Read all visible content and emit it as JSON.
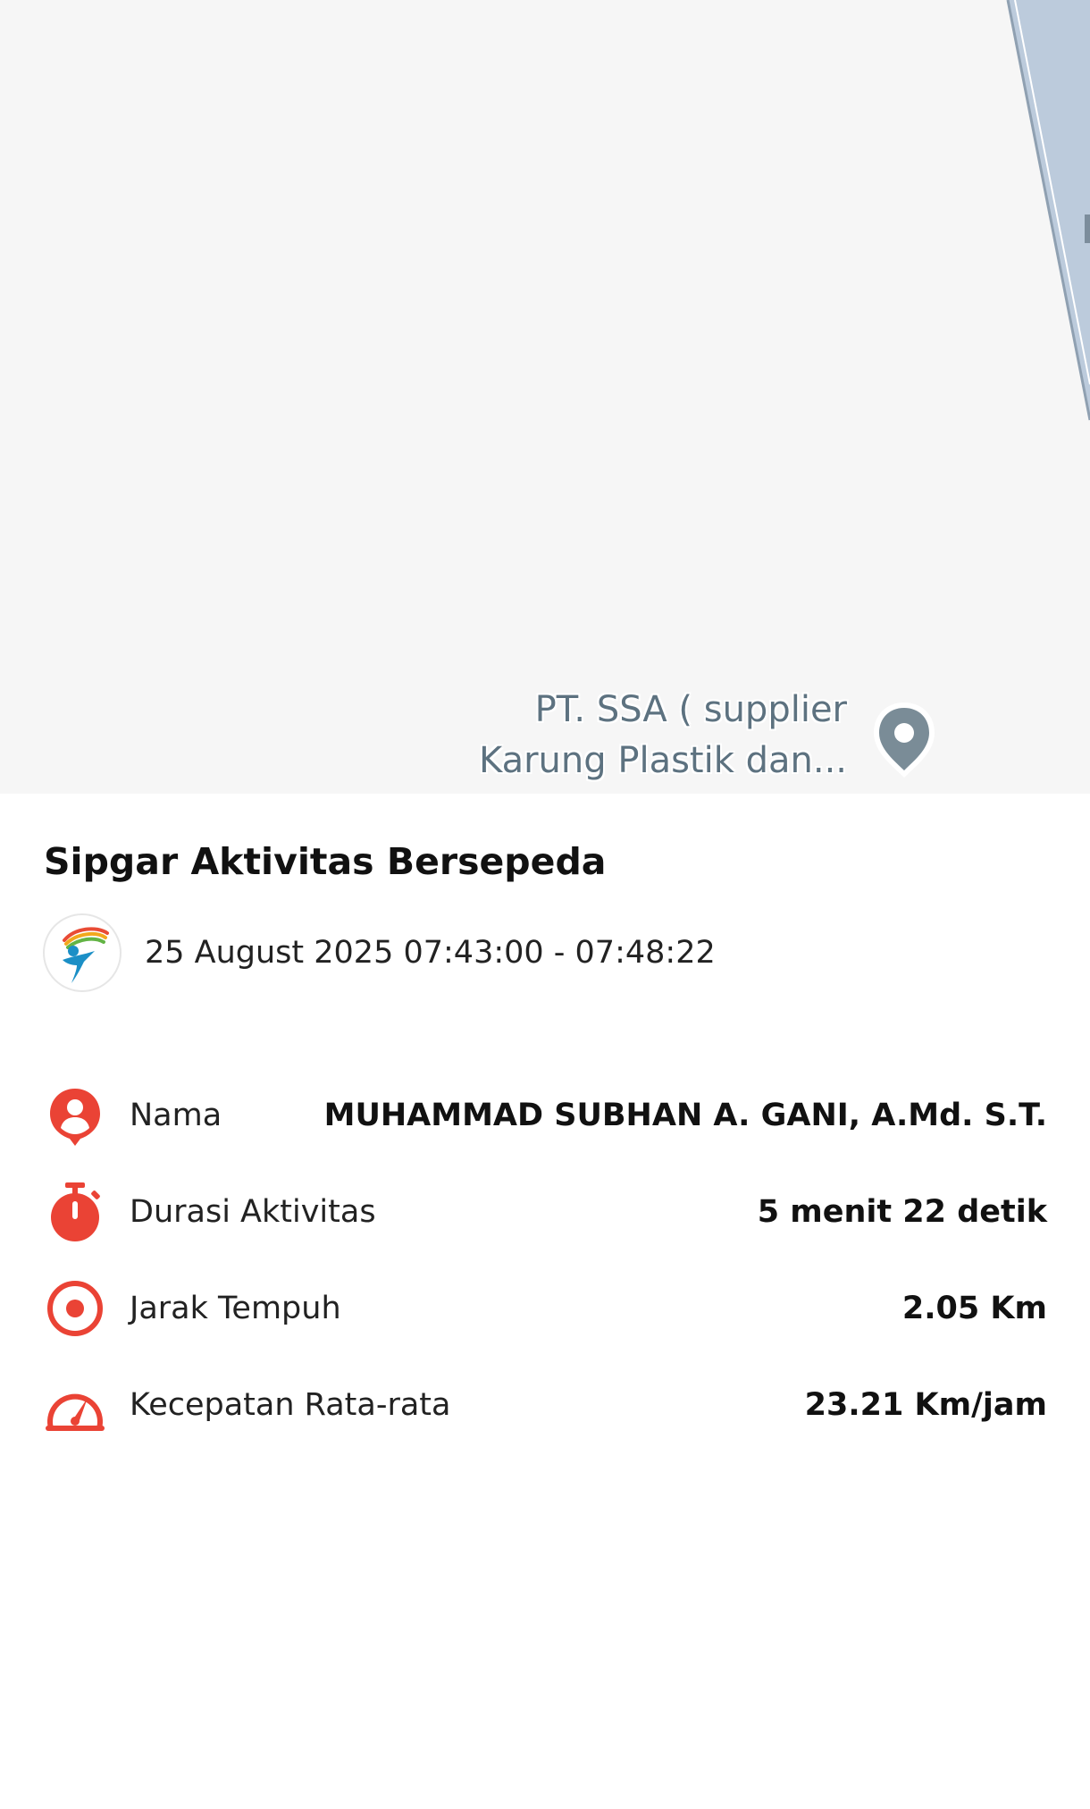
{
  "map": {
    "poi_label_line1": "PT. SSA ( supplier",
    "poi_label_line2": "Karung Plastik dan...",
    "water_color": "#bccbdc",
    "land_color": "#f6f6f6",
    "pin_color": "#7a8c97"
  },
  "sheet": {
    "title": "Sipgar Aktivitas Bersepeda",
    "date_range": "25 August 2025 07:43:00 - 07:48:22",
    "accent_color": "#ea4335",
    "stats": [
      {
        "icon": "person-icon",
        "label": "Nama",
        "value": "MUHAMMAD SUBHAN A. GANI, A.Md. S.T."
      },
      {
        "icon": "stopwatch-icon",
        "label": "Durasi Aktivitas",
        "value": "5 menit 22 detik"
      },
      {
        "icon": "target-icon",
        "label": "Jarak Tempuh",
        "value": "2.05 Km"
      },
      {
        "icon": "speedometer-icon",
        "label": "Kecepatan Rata-rata",
        "value": "23.21 Km/jam"
      }
    ]
  }
}
